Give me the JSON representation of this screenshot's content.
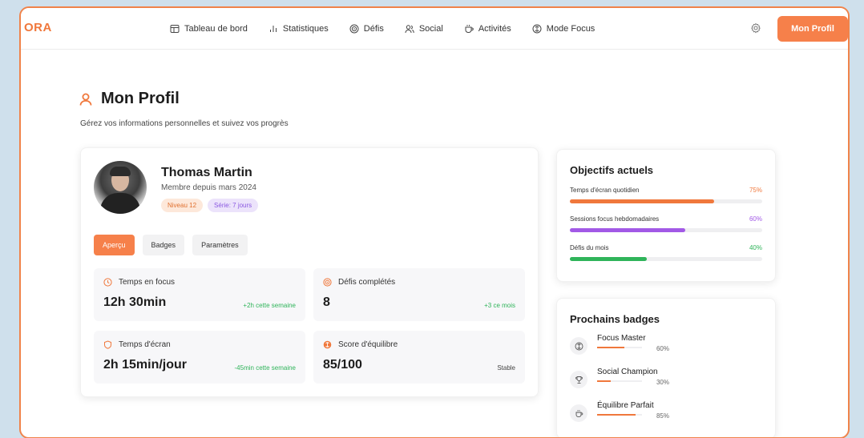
{
  "app": {
    "logo": "ORA"
  },
  "nav": {
    "items": [
      {
        "label": "Tableau de bord",
        "icon": "dashboard-icon"
      },
      {
        "label": "Statistiques",
        "icon": "bar-chart-icon"
      },
      {
        "label": "Défis",
        "icon": "target-icon"
      },
      {
        "label": "Social",
        "icon": "users-icon"
      },
      {
        "label": "Activités",
        "icon": "cup-icon"
      },
      {
        "label": "Mode Focus",
        "icon": "focus-icon"
      }
    ],
    "settings_icon": "gear-icon",
    "profile_button": "Mon Profil"
  },
  "header": {
    "title": "Mon Profil",
    "subtitle": "Gérez vos informations personnelles et suivez vos progrès"
  },
  "profile": {
    "name": "Thomas Martin",
    "member_since": "Membre depuis mars 2024",
    "level": "Niveau 12",
    "streak": "Série: 7 jours"
  },
  "tabs": [
    {
      "label": "Aperçu",
      "active": true
    },
    {
      "label": "Badges",
      "active": false
    },
    {
      "label": "Paramètres",
      "active": false
    }
  ],
  "stats": [
    {
      "label": "Temps en focus",
      "value": "12h 30min",
      "note": "+2h cette semaine",
      "icon": "clock-icon"
    },
    {
      "label": "Défis complétés",
      "value": "8",
      "note": "+3 ce mois",
      "icon": "target-icon"
    },
    {
      "label": "Temps d'écran",
      "value": "2h 15min/jour",
      "note": "-45min cette semaine",
      "icon": "shield-icon"
    },
    {
      "label": "Score d'équilibre",
      "value": "85/100",
      "note": "Stable",
      "icon": "balance-icon"
    }
  ],
  "goals": {
    "title": "Objectifs actuels",
    "items": [
      {
        "label": "Temps d'écran quotidien",
        "percent_label": "75%",
        "progress": 0.75,
        "color": "#f0783c"
      },
      {
        "label": "Sessions focus hebdomadaires",
        "percent_label": "60%",
        "progress": 0.6,
        "color": "#a259e6"
      },
      {
        "label": "Défis du mois",
        "percent_label": "40%",
        "progress": 0.4,
        "color": "#2fb45a"
      }
    ]
  },
  "next_badges": {
    "title": "Prochains badges",
    "items": [
      {
        "name": "Focus Master",
        "percent_label": "60%",
        "progress": 0.6,
        "icon": "focus-icon"
      },
      {
        "name": "Social Champion",
        "percent_label": "30%",
        "progress": 0.3,
        "icon": "trophy-icon"
      },
      {
        "name": "Équilibre Parfait",
        "percent_label": "85%",
        "progress": 0.85,
        "icon": "cup-icon"
      }
    ]
  },
  "colors": {
    "accent": "#f6804a",
    "purple": "#a259e6",
    "green": "#2fb45a"
  }
}
